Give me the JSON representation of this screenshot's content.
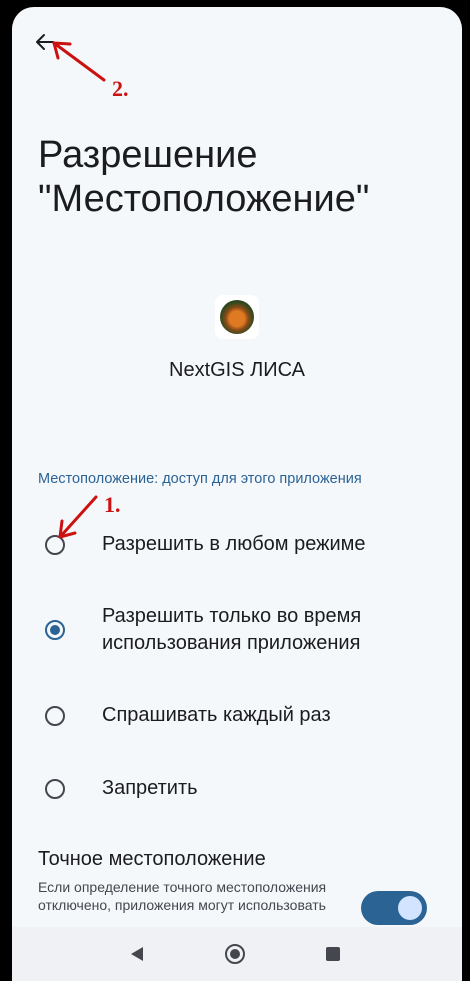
{
  "header": {
    "title": "Разрешение \"Местоположение\""
  },
  "app": {
    "name": "NextGIS ЛИСА",
    "icon": "fox-logo-icon"
  },
  "permission": {
    "section_label": "Местоположение: доступ для этого приложения",
    "options": [
      {
        "label": "Разрешить в любом режиме",
        "selected": false
      },
      {
        "label": "Разрешить только во время использования приложения",
        "selected": true
      },
      {
        "label": "Спрашивать каждый раз",
        "selected": false
      },
      {
        "label": "Запретить",
        "selected": false
      }
    ]
  },
  "precise": {
    "title": "Точное местоположение",
    "description": "Если определение точного местоположения отключено, приложения могут использовать",
    "enabled": true
  },
  "annotations": {
    "step1": "1.",
    "step2": "2."
  },
  "colors": {
    "accent": "#2b6395",
    "annotation": "#cc1111",
    "background": "#f5f8fb"
  }
}
